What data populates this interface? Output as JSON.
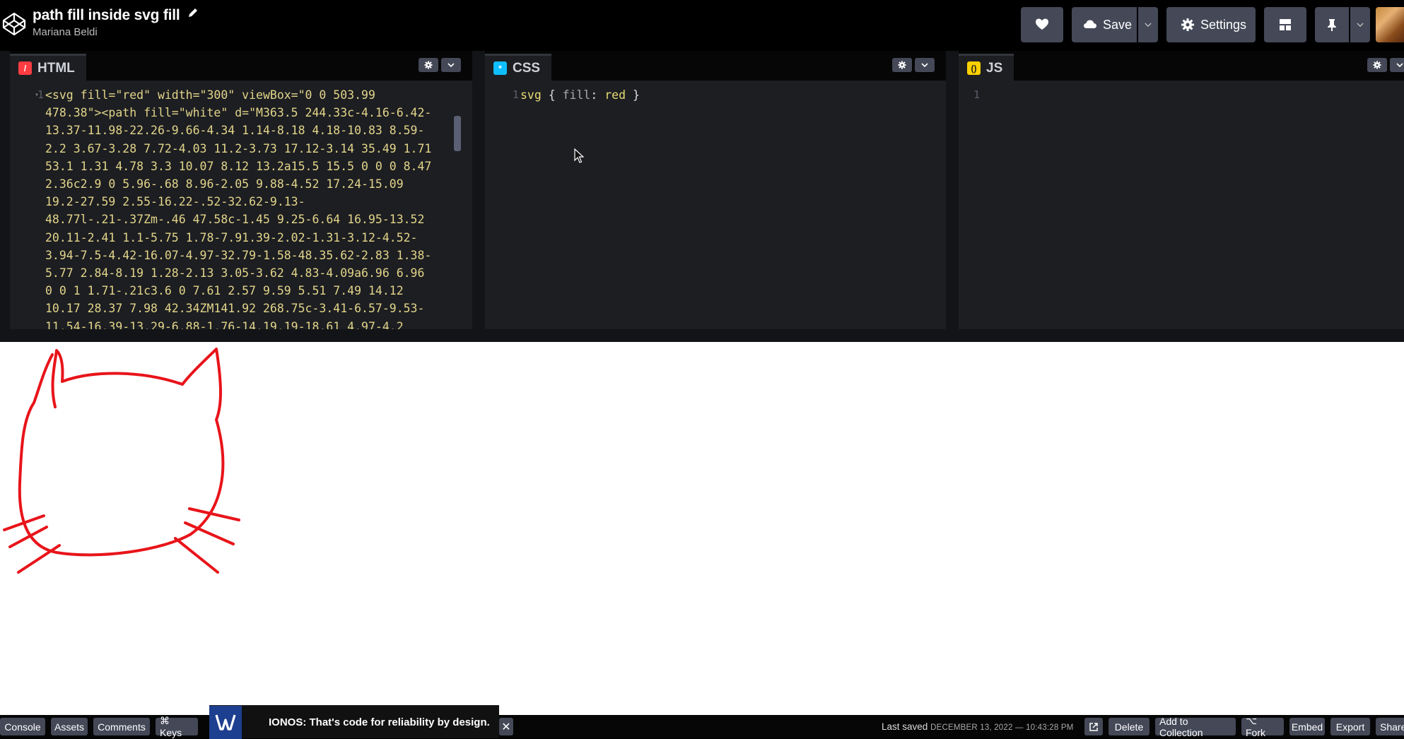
{
  "header": {
    "title": "path fill inside svg fill",
    "author": "Mariana Beldi",
    "save_label": "Save",
    "settings_label": "Settings"
  },
  "editors": {
    "html": {
      "label": "HTML",
      "line_number": "1",
      "lines": [
        "<svg fill=\"red\" width=\"300\" viewBox=\"0 0 503.99",
        "478.38\"><path fill=\"white\" d=\"M363.5 244.33c-4.16-6.42-",
        "13.37-11.98-22.26-9.66-4.34 1.14-8.18 4.18-10.83 8.59-",
        "2.2 3.67-3.28 7.72-4.03 11.2-3.73 17.12-3.14 35.49 1.71",
        "53.1 1.31 4.78 3.3 10.07 8.12 13.2a15.5 15.5 0 0 0 8.47",
        "2.36c2.9 0 5.96-.68 8.96-2.05 9.88-4.52 17.24-15.09",
        "19.2-27.59 2.55-16.22-.52-32.62-9.13-",
        "48.77l-.21-.37Zm-.46 47.58c-1.45 9.25-6.64 16.95-13.52",
        "20.11-2.41 1.1-5.75 1.78-7.91.39-2.02-1.31-3.12-4.52-",
        "3.94-7.5-4.42-16.07-4.97-32.79-1.58-48.35.62-2.83 1.38-",
        "5.77 2.84-8.19 1.28-2.13 3.05-3.62 4.83-4.09a6.96 6.96",
        "0 0 1 1.71-.21c3.6 0 7.61 2.57 9.59 5.51 7.49 14.12",
        "10.17 28.37 7.98 42.34ZM141.92 268.75c-3.41-6.57-9.53-",
        "11.54-16.39-13.29-6.88-1.76-14.19.19-18.61 4.97-4.2"
      ]
    },
    "css": {
      "label": "CSS",
      "line_number": "1",
      "selector": "svg",
      "open": " { ",
      "property": "fill",
      "colon": ": ",
      "value": "red",
      "close": " }"
    },
    "js": {
      "label": "JS",
      "line_number": "1"
    }
  },
  "footer": {
    "console": "Console",
    "assets": "Assets",
    "comments": "Comments",
    "keys": "⌘ Keys",
    "ad_text": "IONOS: That's code for reliability by design.",
    "ad_close": "✕",
    "last_saved_label": "Last saved",
    "last_saved_date": "DECEMBER 13, 2022 — 10:43:28 PM",
    "delete": "Delete",
    "add_to_collection": "Add to Collection",
    "fork": "⌥ Fork",
    "embed": "Embed",
    "export": "Export",
    "share": "Share"
  },
  "colors": {
    "accent_html": "#ff3c41",
    "accent_css": "#0ebeff",
    "accent_js": "#fcd000",
    "cat_stroke": "#e8141a"
  }
}
